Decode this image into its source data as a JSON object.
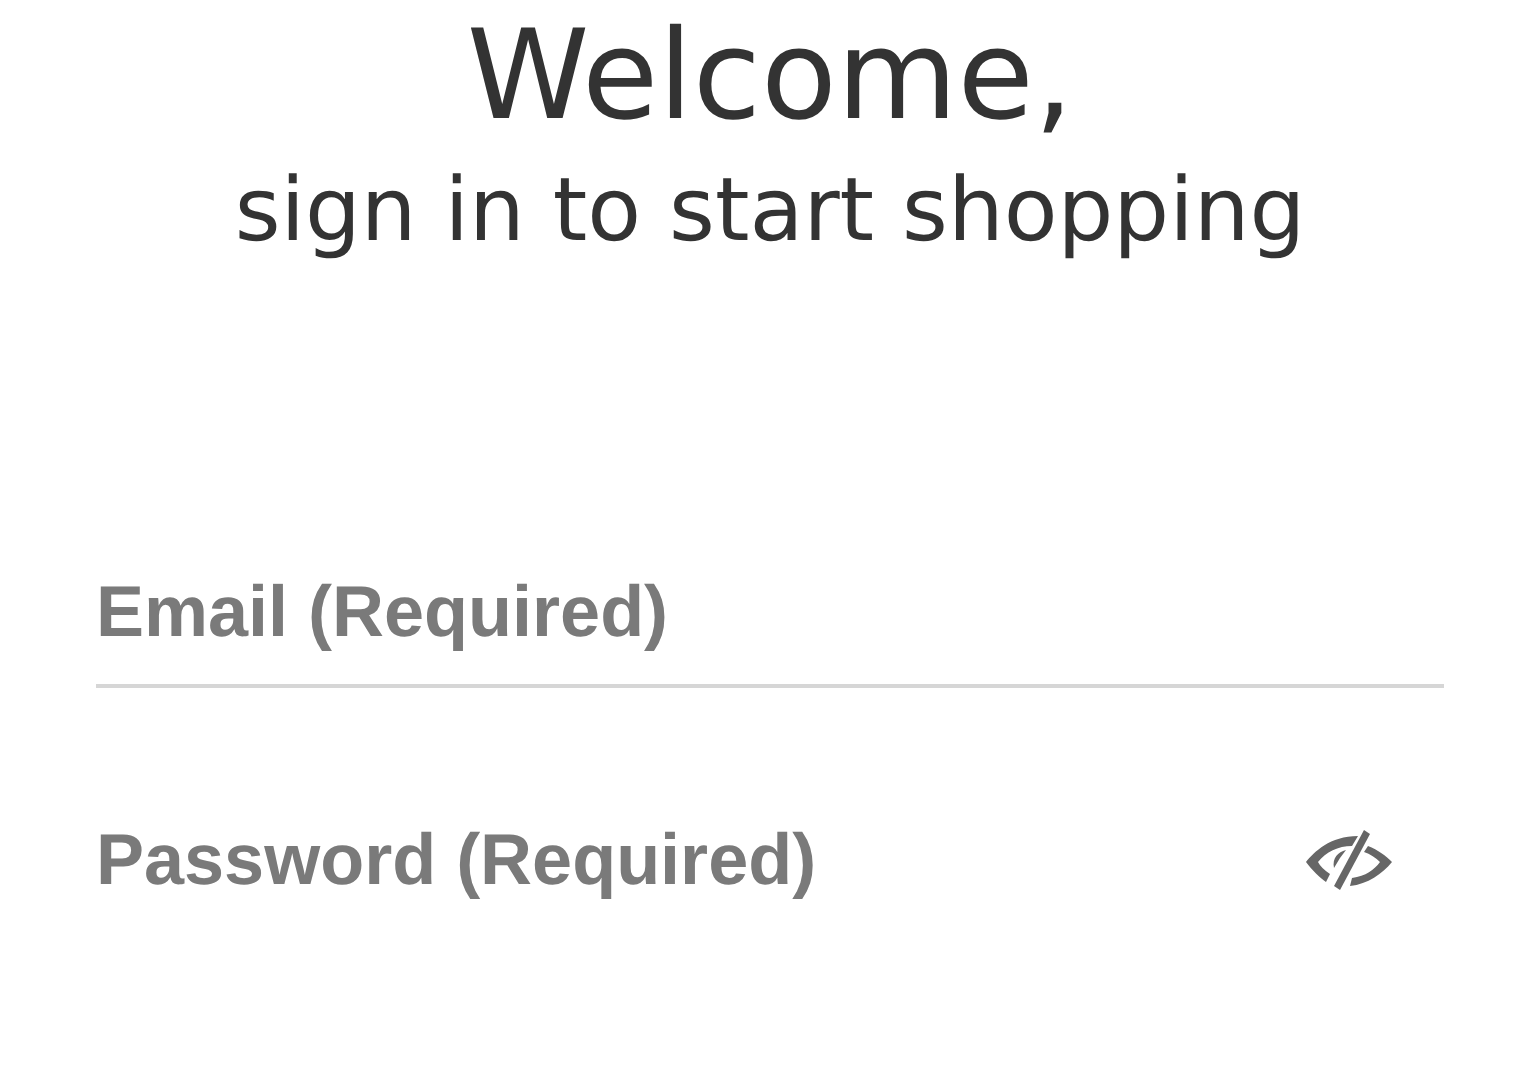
{
  "heading": {
    "title": "Welcome,",
    "subtitle": "sign in to start shopping"
  },
  "fields": [
    {
      "placeholder": "Email (Required)",
      "kind": "email"
    },
    {
      "placeholder": "Password (Required)",
      "kind": "password"
    }
  ]
}
